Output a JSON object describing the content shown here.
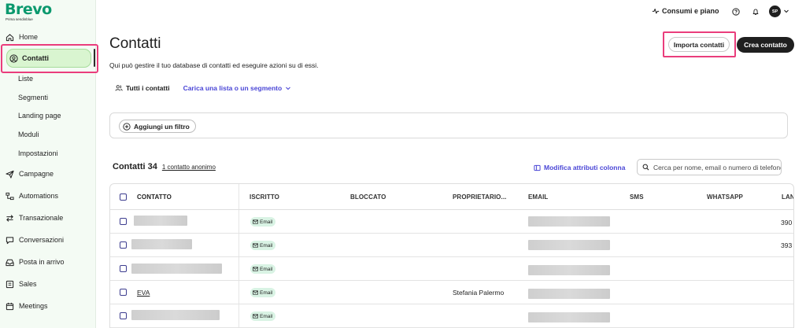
{
  "brand": {
    "name": "Brevo",
    "sub": "Prima sendinblue",
    "color": "#0b996e"
  },
  "sidebar": {
    "items": [
      {
        "label": "Home",
        "icon": "home-icon"
      },
      {
        "label": "Contatti",
        "icon": "user-circle-icon",
        "active": true
      },
      {
        "label": "Campagne",
        "icon": "send-icon"
      },
      {
        "label": "Automations",
        "icon": "automation-icon"
      },
      {
        "label": "Transazionale",
        "icon": "arrows-swap-icon"
      },
      {
        "label": "Conversazioni",
        "icon": "chat-icon"
      },
      {
        "label": "Posta in arrivo",
        "icon": "inbox-icon"
      },
      {
        "label": "Sales",
        "icon": "sales-icon"
      },
      {
        "label": "Meetings",
        "icon": "calendar-icon"
      }
    ],
    "subitems": [
      "Liste",
      "Segmenti",
      "Landing page",
      "Moduli",
      "Impostazioni"
    ]
  },
  "topbar": {
    "usage_label": "Consumi e piano",
    "avatar_initials": "SP"
  },
  "page": {
    "title": "Contatti",
    "description": "Qui può gestire il tuo database di contatti ed eseguire azioni su di essi."
  },
  "buttons": {
    "import": "Importa contatti",
    "create": "Crea contatto"
  },
  "tabs": {
    "all": "Tutti i contatti",
    "load": "Carica una lista o un segmento"
  },
  "filter": {
    "add_label": "Aggiungi un filtro"
  },
  "contacts": {
    "title": "Contatti 34",
    "anonymous": "1 contatto anonimo",
    "modify_attributes": "Modifica attributi colonna",
    "search_placeholder": "Cerca per nome, email o numero di telefono"
  },
  "table": {
    "columns": [
      "CONTATTO",
      "ISCRITTO",
      "BLOCCATO",
      "PROPRIETARIO...",
      "EMAIL",
      "SMS",
      "WHATSAPP",
      "LAN"
    ],
    "rows": [
      {
        "contact": "",
        "subscribed": "Email",
        "owner": "",
        "lan": "390"
      },
      {
        "contact": "",
        "subscribed": "Email",
        "owner": "",
        "lan": "393"
      },
      {
        "contact": "",
        "subscribed": "Email",
        "owner": "",
        "lan": ""
      },
      {
        "contact": "EVA",
        "subscribed": "Email",
        "owner": "Stefania Palermo",
        "lan": ""
      },
      {
        "contact": "",
        "subscribed": "Email",
        "owner": "",
        "lan": ""
      }
    ]
  },
  "colors": {
    "highlight": "#ea3d7c",
    "link": "#4a46d6",
    "active_bg": "#d9f5d0",
    "badge_bg": "#d9f3e4"
  }
}
